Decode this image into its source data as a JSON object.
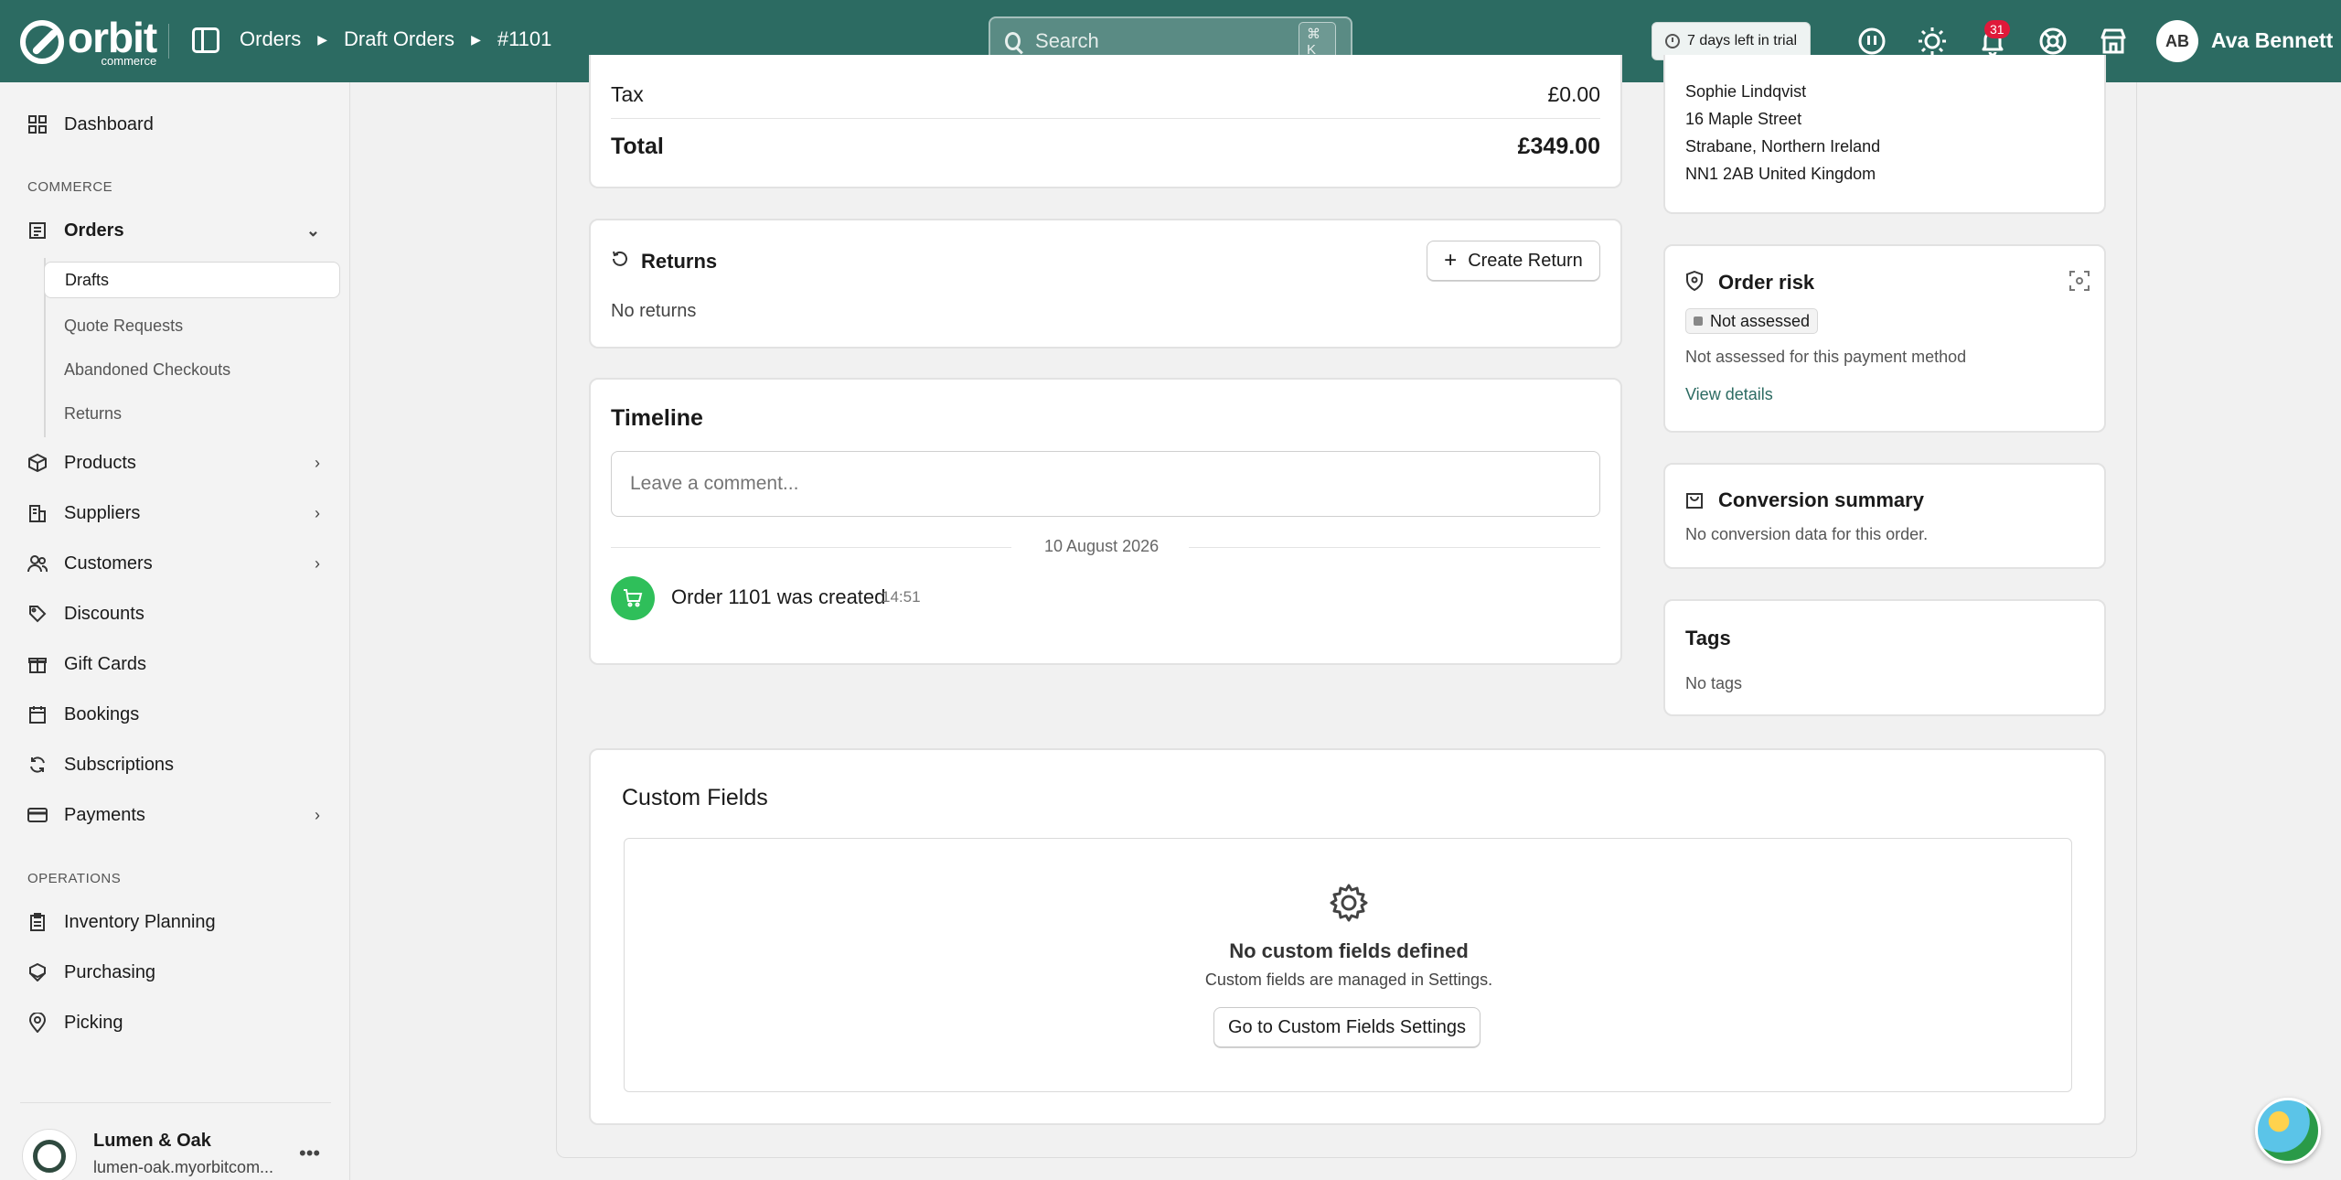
{
  "topbar": {
    "logo_text": "orbit",
    "logo_sub": "commerce",
    "breadcrumb": [
      "Orders",
      "Draft Orders",
      "#1101"
    ],
    "search_placeholder": "Search",
    "search_shortcut": "⌘ K",
    "trial_text": "7 days left in trial",
    "notification_count": "31",
    "user_initials": "AB",
    "user_name": "Ava Bennett"
  },
  "sidebar": {
    "dashboard": "Dashboard",
    "commerce_label": "COMMERCE",
    "orders": "Orders",
    "order_subitems": [
      "Drafts",
      "Quote Requests",
      "Abandoned Checkouts",
      "Returns"
    ],
    "commerce_items": [
      "Products",
      "Suppliers",
      "Customers",
      "Discounts",
      "Gift Cards",
      "Bookings",
      "Subscriptions",
      "Payments"
    ],
    "operations_label": "OPERATIONS",
    "operations_items": [
      "Inventory Planning",
      "Purchasing",
      "Picking"
    ],
    "store_name": "Lumen & Oak",
    "store_url": "lumen-oak.myorbitcom..."
  },
  "summary": {
    "tax_label": "Tax",
    "tax_value": "£0.00",
    "total_label": "Total",
    "total_value": "£349.00"
  },
  "returns": {
    "title": "Returns",
    "create_button": "Create Return",
    "empty": "No returns"
  },
  "timeline": {
    "title": "Timeline",
    "comment_placeholder": "Leave a comment...",
    "date": "10 August 2026",
    "event_text": "Order 1101 was created",
    "event_time": "14:51"
  },
  "address": {
    "name": "Sophie Lindqvist",
    "line1": "16 Maple Street",
    "line2": "Strabane, Northern Ireland",
    "line3": "NN1 2AB United Kingdom"
  },
  "risk": {
    "title": "Order risk",
    "status": "Not assessed",
    "description": "Not assessed for this payment method",
    "link": "View details"
  },
  "conversion": {
    "title": "Conversion summary",
    "text": "No conversion data for this order."
  },
  "tags": {
    "title": "Tags",
    "text": "No tags"
  },
  "custom_fields": {
    "title": "Custom Fields",
    "empty_title": "No custom fields defined",
    "empty_text": "Custom fields are managed in Settings.",
    "button": "Go to Custom Fields Settings"
  },
  "colors": {
    "brand": "#2c6b62",
    "badge": "#e0193a",
    "success": "#2fbf5a"
  }
}
